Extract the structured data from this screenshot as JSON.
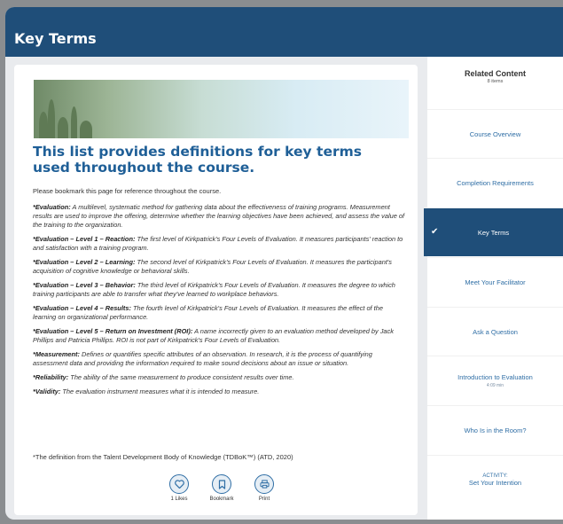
{
  "header": {
    "title": "Key Terms"
  },
  "main": {
    "heading": "This list provides definitions for key terms used throughout the course.",
    "intro": "Please bookmark this page for reference throughout the course.",
    "terms": [
      {
        "term": "*Evaluation:",
        "definition": " A multilevel, systematic method for gathering data about the effectiveness of training programs. Measurement results are used to improve the offering, determine whether the learning objectives have been achieved, and assess the value of the training to the organization."
      },
      {
        "term": "*Evaluation – Level 1 – Reaction:",
        "definition": " The first level of Kirkpatrick's Four Levels of Evaluation. It measures participants' reaction to and satisfaction with a training program."
      },
      {
        "term": "*Evaluation – Level 2 – Learning:",
        "definition": " The second level of Kirkpatrick's Four Levels of Evaluation. It measures the participant's acquisition of cognitive knowledge or behavioral skills."
      },
      {
        "term": "*Evaluation – Level 3 – Behavior:",
        "definition": " The third level of Kirkpatrick's Four Levels of Evaluation. It measures the degree to which training participants are able to transfer what they've learned to workplace behaviors."
      },
      {
        "term": "*Evaluation – Level 4 – Results:",
        "definition": " The fourth level of Kirkpatrick's Four Levels of Evaluation. It measures the effect of the learning on organizational performance."
      },
      {
        "term": "*Evaluation – Level 5 – Return on Investment (ROI):",
        "definition": " A name incorrectly given to an evaluation method developed by Jack Phillips and Patricia Phillips. ROI is not part of Kirkpatrick's Four Levels of Evaluation."
      },
      {
        "term": "*Measurement:",
        "definition": " Defines or quantifies specific attributes of an observation. In research, it is the process of quantifying assessment data and providing the information required to make sound decisions about an issue or situation."
      },
      {
        "term": "*Reliability:",
        "definition": " The ability of the same measurement to produce consistent results over time."
      },
      {
        "term": "*Validity:",
        "definition": " The evaluation instrument measures what it is intended to measure."
      }
    ],
    "footnote": "*The definition from the Talent Development Body of Knowledge (TDBoK™) (ATD, 2020)",
    "actions": {
      "likes_label": "1 Likes",
      "bookmark_label": "Bookmark",
      "print_label": "Print"
    }
  },
  "sidebar": {
    "title": "Related Content",
    "count": "8 items",
    "items": [
      {
        "label": "Course Overview",
        "sub": ""
      },
      {
        "label": "Completion Requirements",
        "sub": ""
      },
      {
        "label": "Key Terms",
        "sub": "",
        "active": true
      },
      {
        "label": "Meet Your Facilitator",
        "sub": ""
      },
      {
        "label": "Ask a Question",
        "sub": ""
      },
      {
        "label": "Introduction to Evaluation",
        "sub": "4:09 min"
      },
      {
        "label": "Who Is in the Room?",
        "sub": ""
      },
      {
        "label": "ACTIVITY:",
        "sub": "",
        "label2": "Set Your Intention"
      }
    ]
  },
  "colors": {
    "brand": "#1f4e79",
    "heading": "#1f5f97",
    "link": "#2f6ea5"
  }
}
